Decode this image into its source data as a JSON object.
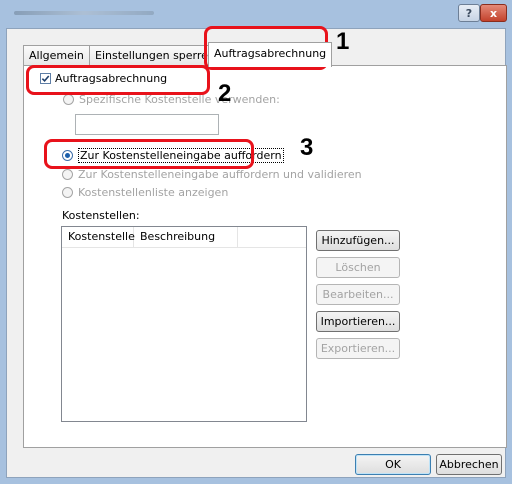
{
  "window": {
    "help_label": "?",
    "close_label": "x"
  },
  "tabs": [
    {
      "label": "Allgemein"
    },
    {
      "label": "Einstellungen sperren"
    },
    {
      "label": "Auftragsabrechnung"
    }
  ],
  "job_accounting": {
    "checkbox_label": "Auftragsabrechnung",
    "checked": true
  },
  "options": [
    {
      "label": "Spezifische Kostenstelle verwenden:",
      "enabled": false
    },
    {
      "label": "Zur Kostenstelleneingabe auffordern",
      "enabled": true,
      "selected": true
    },
    {
      "label": "Zur Kostenstelleneingabe auffordern und validieren",
      "enabled": false
    },
    {
      "label": "Kostenstellenliste anzeigen",
      "enabled": false
    }
  ],
  "cost_centers": {
    "label": "Kostenstellen:",
    "columns": [
      "Kostenstelle",
      "Beschreibung"
    ],
    "rows": []
  },
  "side_buttons": [
    {
      "label": "Hinzufügen...",
      "enabled": true
    },
    {
      "label": "Löschen",
      "enabled": false
    },
    {
      "label": "Bearbeiten...",
      "enabled": false
    },
    {
      "label": "Importieren...",
      "enabled": true
    },
    {
      "label": "Exportieren...",
      "enabled": false
    }
  ],
  "footer": {
    "ok_label": "OK",
    "cancel_label": "Abbrechen"
  },
  "annotations": [
    {
      "number": "1"
    },
    {
      "number": "2"
    },
    {
      "number": "3"
    }
  ],
  "colors": {
    "annotation_red": "#e8121b",
    "frame_blue": "#a7c1df"
  }
}
